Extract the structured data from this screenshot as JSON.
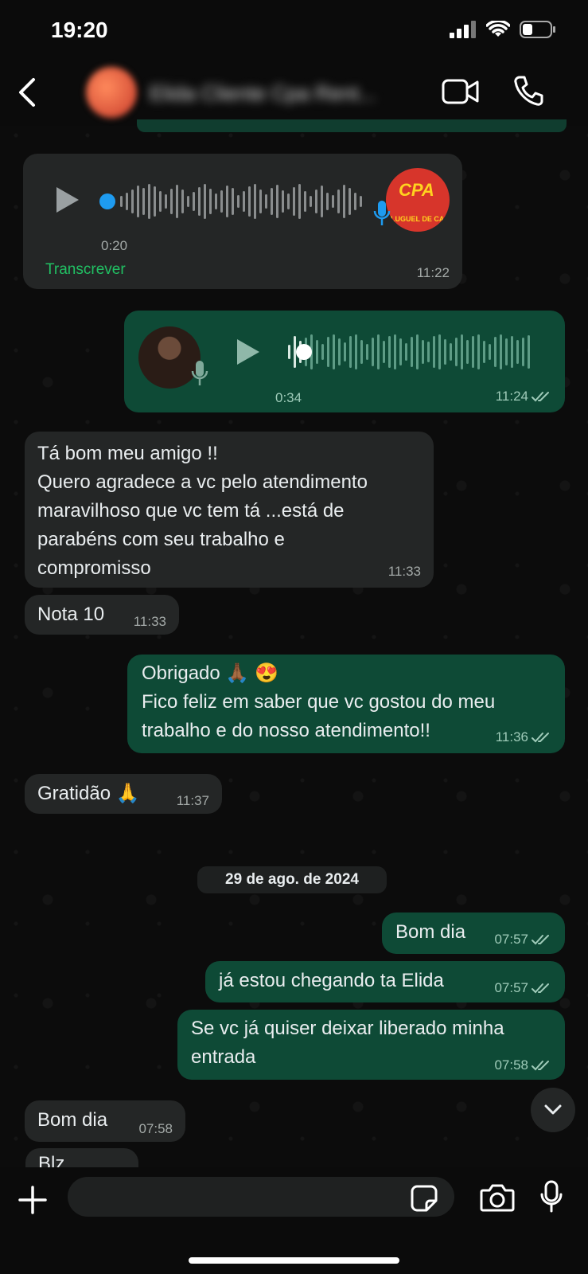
{
  "status_bar": {
    "time": "19:20"
  },
  "header": {
    "contact_name": "Elida Cliente Cpa Rent..."
  },
  "voice_messages": [
    {
      "direction": "in",
      "duration": "0:20",
      "time": "11:22",
      "transcribe_label": "Transcrever",
      "avatar_text": "CPA",
      "avatar_subtext": "LUGUEL DE CARRO"
    },
    {
      "direction": "out",
      "duration": "0:34",
      "time": "11:24"
    }
  ],
  "messages": [
    {
      "direction": "in",
      "text": "Tá bom meu amigo !!\nQuero agradece a vc pelo atendimento\nmaravilhoso que vc tem tá ...está de\nparabéns com seu trabalho e\ncompromisso",
      "time": "11:33"
    },
    {
      "direction": "in",
      "text": "Nota 10",
      "time": "11:33"
    },
    {
      "direction": "out",
      "text": "Obrigado 🙏🏾 😍\nFico feliz em saber que vc gostou do meu\ntrabalho e do nosso atendimento!!",
      "time": "11:36"
    },
    {
      "direction": "in",
      "text": "Gratidão 🙏",
      "time": "11:37"
    },
    {
      "direction": "out",
      "text": "Bom dia",
      "time": "07:57"
    },
    {
      "direction": "out",
      "text": "já estou chegando ta Elida",
      "time": "07:57"
    },
    {
      "direction": "out",
      "text": "Se vc já quiser deixar liberado minha\nentrada",
      "time": "07:58"
    },
    {
      "direction": "in",
      "text": "Bom dia",
      "time": "07:58"
    },
    {
      "direction": "in",
      "text": "Blz",
      "time": ""
    }
  ],
  "date_separator": "29 de ago. de 2024",
  "input": {
    "placeholder": ""
  },
  "colors": {
    "incoming": "#242626",
    "outgoing": "#0e4a36",
    "accent": "#21c063",
    "voice_dot": "#1e9bf0"
  },
  "icons": [
    "back-icon",
    "video-call-icon",
    "phone-call-icon",
    "play-icon",
    "mic-icon",
    "double-check-icon",
    "chevron-down-icon",
    "plus-icon",
    "sticker-icon",
    "camera-icon",
    "microphone-icon",
    "signal-icon",
    "wifi-icon",
    "battery-icon"
  ]
}
